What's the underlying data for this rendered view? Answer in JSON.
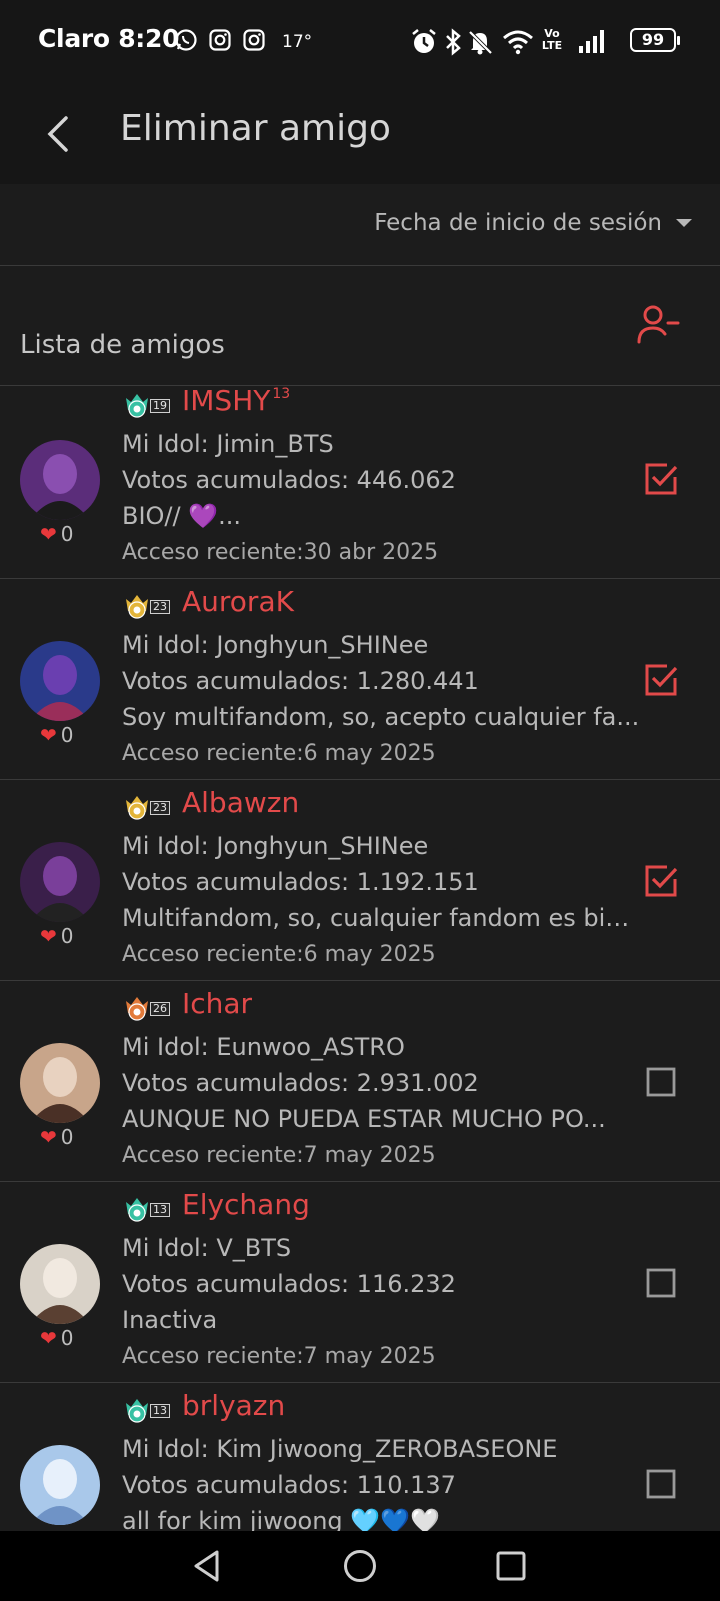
{
  "status_bar": {
    "carrier": "Claro",
    "time": "8:20",
    "temperature": "17°",
    "battery": "99",
    "network": "Vo LTE",
    "icons_left": [
      "whatsapp-icon",
      "instagram-icon",
      "instagram-icon"
    ],
    "icons_right": [
      "alarm-icon",
      "bluetooth-icon",
      "mute-icon",
      "wifi-icon",
      "volte-icon",
      "signal-icon",
      "battery-icon"
    ]
  },
  "header": {
    "title": "Eliminar amigo"
  },
  "sort": {
    "label": "Fecha de inicio de sesión"
  },
  "list": {
    "title": "Lista de amigos"
  },
  "accent_color": "#e24a4a",
  "friends": [
    {
      "badge_level": "19",
      "name": "IMSHY",
      "name_sup": "13",
      "idol": "Mi Idol: Jimin_BTS",
      "votes": "Votos acumulados: 446.062",
      "bio": "BIO// 💜...",
      "last_access": "Acceso reciente:30 abr 2025",
      "likes": "0",
      "checked": true
    },
    {
      "badge_level": "23",
      "name": "AuroraK",
      "name_sup": "",
      "idol": "Mi Idol: Jonghyun_SHINee",
      "votes": "Votos acumulados: 1.280.441",
      "bio": "Soy multifandom, so, acepto cualquier fa...",
      "last_access": "Acceso reciente:6 may 2025",
      "likes": "0",
      "checked": true
    },
    {
      "badge_level": "23",
      "name": "Albawzn",
      "name_sup": "",
      "idol": "Mi Idol: Jonghyun_SHINee",
      "votes": "Votos acumulados: 1.192.151",
      "bio": "Multifandom, so, cualquier fandom es bie...",
      "last_access": "Acceso reciente:6 may 2025",
      "likes": "0",
      "checked": true
    },
    {
      "badge_level": "26",
      "name": "Ichar",
      "name_sup": "",
      "idol": "Mi Idol: Eunwoo_ASTRO",
      "votes": "Votos acumulados: 2.931.002",
      "bio": "AUNQUE NO PUEDA ESTAR MUCHO PO...",
      "last_access": "Acceso reciente:7 may 2025",
      "likes": "0",
      "checked": false
    },
    {
      "badge_level": "13",
      "name": "Elychang",
      "name_sup": "",
      "idol": "Mi Idol: V_BTS",
      "votes": "Votos acumulados: 116.232",
      "bio": "Inactiva",
      "last_access": "Acceso reciente:7 may 2025",
      "likes": "0",
      "checked": false
    },
    {
      "badge_level": "13",
      "name": "brlyazn",
      "name_sup": "",
      "idol": "Mi Idol: Kim Jiwoong_ZEROBASEONE",
      "votes": "Votos acumulados: 110.137",
      "bio": "all for kim jiwoong 🩵💙🤍",
      "last_access": "",
      "likes": "",
      "checked": false
    }
  ]
}
